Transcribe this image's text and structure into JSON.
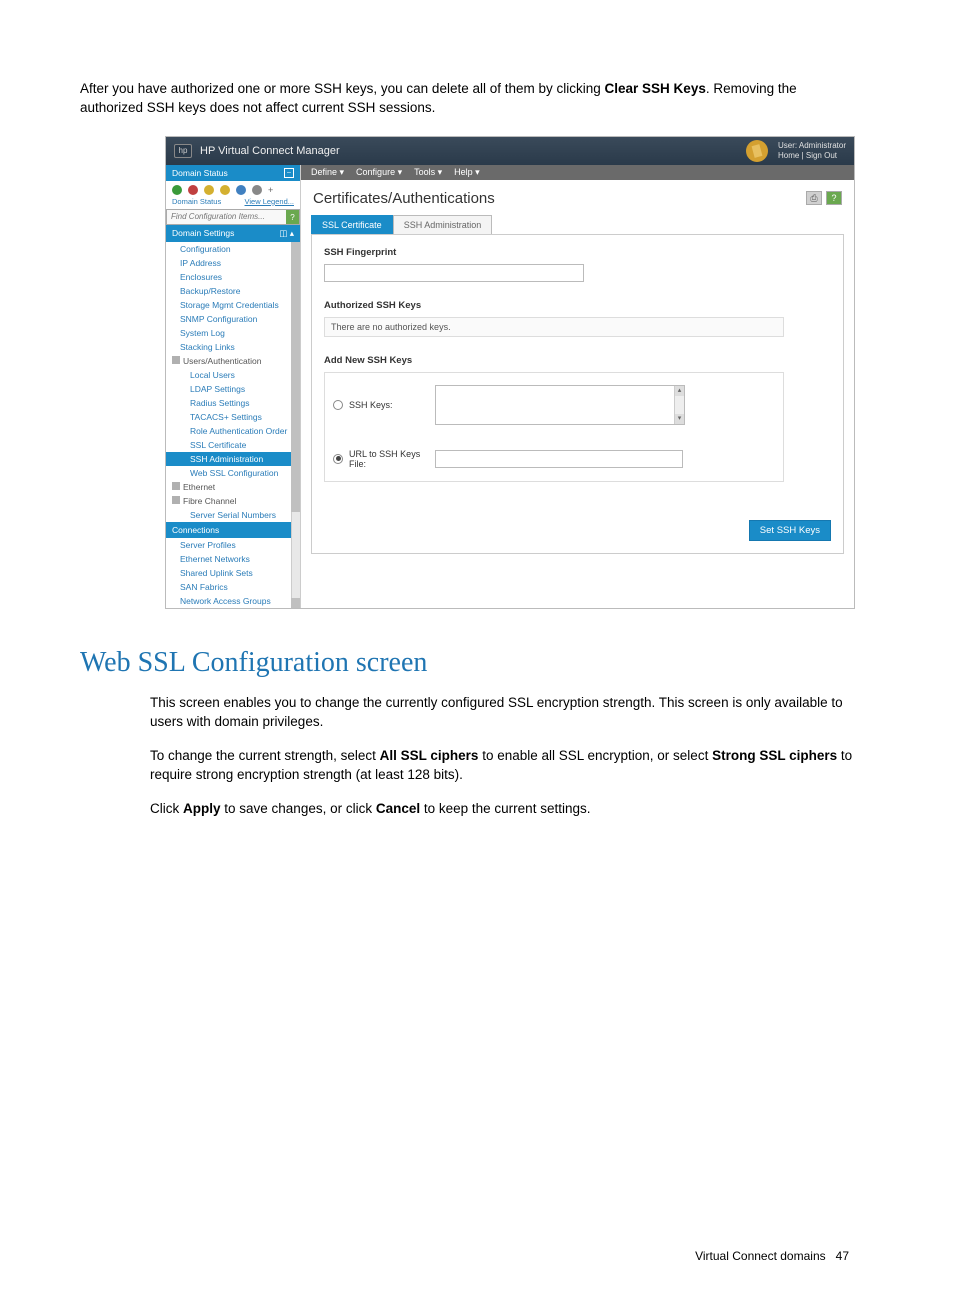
{
  "intro": {
    "pre": "After you have authorized one or more SSH keys, you can delete all of them by clicking ",
    "bold": "Clear SSH Keys",
    "post": ". Removing the authorized SSH keys does not affect current SSH sessions."
  },
  "app": {
    "title": "HP Virtual Connect Manager",
    "user_label": "User:",
    "user_value": "Administrator",
    "home": "Home",
    "signout": "Sign Out",
    "menubar": {
      "define": "Define ▾",
      "configure": "Configure ▾",
      "tools": "Tools ▾",
      "help": "Help ▾"
    },
    "domain_status_label": "Domain Status",
    "domain_status_word": "Domain Status",
    "view_legend": "View Legend...",
    "search_placeholder": "Find Configuration Items...",
    "section_domain_settings": "Domain Settings",
    "tree": {
      "domain_settings": [
        "Configuration",
        "IP Address",
        "Enclosures",
        "Backup/Restore",
        "Storage Mgmt Credentials",
        "SNMP Configuration",
        "System Log",
        "Stacking Links"
      ],
      "users_auth_label": "Users/Authentication",
      "users_auth": [
        "Local Users",
        "LDAP Settings",
        "Radius Settings",
        "TACACS+ Settings",
        "Role Authentication Order",
        "SSL Certificate",
        "SSH Administration",
        "Web SSL Configuration"
      ],
      "ethernet_label": "Ethernet",
      "fibre_label": "Fibre Channel",
      "fibre": [
        "Server Serial Numbers"
      ],
      "connections_label": "Connections",
      "connections": [
        "Server Profiles",
        "Ethernet Networks",
        "Shared Uplink Sets",
        "SAN Fabrics",
        "Network Access Groups"
      ]
    },
    "page_title": "Certificates/Authentications",
    "tabs": {
      "ssl": "SSL Certificate",
      "ssh": "SSH Administration"
    },
    "panel": {
      "fingerprint_label": "SSH Fingerprint",
      "auth_keys_label": "Authorized SSH Keys",
      "no_keys_text": "There are no authorized keys.",
      "add_new_label": "Add New SSH Keys",
      "ssh_keys_label": "SSH Keys:",
      "url_label": "URL to SSH Keys File:",
      "set_button": "Set SSH Keys"
    },
    "help_icon": "?",
    "print_icon": "⎙"
  },
  "section2": {
    "heading": "Web SSL Configuration screen",
    "p1": "This screen enables you to change the currently configured SSL encryption strength. This screen is only available to users with domain privileges.",
    "p2_a": "To change the current strength, select ",
    "p2_b1": "All SSL ciphers",
    "p2_c": " to enable all SSL encryption, or select ",
    "p2_b2": "Strong SSL ciphers",
    "p2_d": " to require strong encryption strength (at least 128 bits).",
    "p3_a": "Click ",
    "p3_b1": "Apply",
    "p3_c": " to save changes, or click ",
    "p3_b2": "Cancel",
    "p3_d": " to keep the current settings."
  },
  "footer": {
    "text": "Virtual Connect domains",
    "page": "47"
  }
}
